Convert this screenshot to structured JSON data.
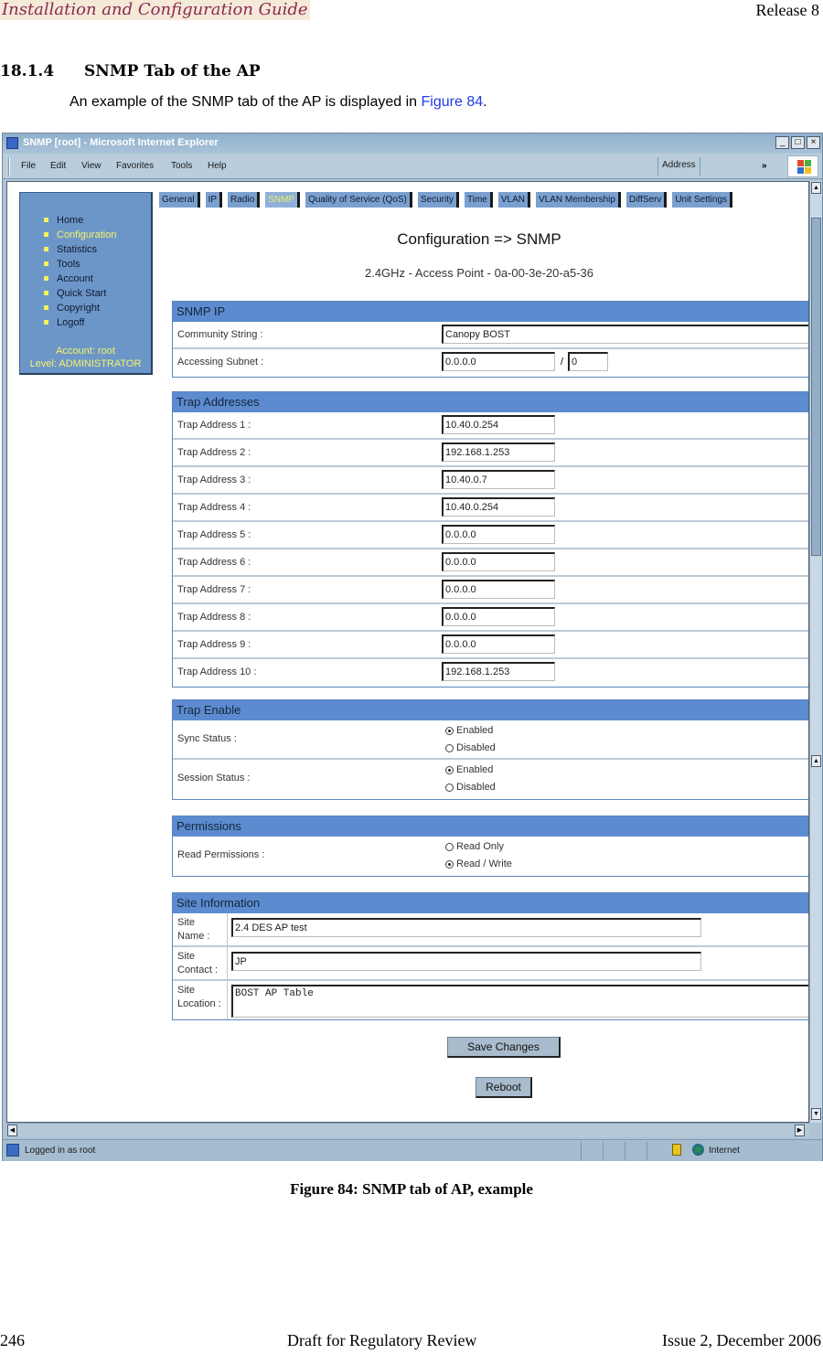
{
  "document": {
    "header_left": "Installation and Configuration Guide",
    "header_right": "Release 8",
    "section_number": "18.1.4",
    "section_title": "SNMP Tab of the AP",
    "intro_text": "An example of the SNMP tab of the AP is displayed in ",
    "intro_link": "Figure 84",
    "intro_end": ".",
    "caption": "Figure 84: SNMP tab of AP, example",
    "footer_page": "246",
    "footer_center": "Draft for Regulatory Review",
    "footer_right": "Issue 2, December 2006"
  },
  "browser": {
    "title": "SNMP [root] - Microsoft Internet Explorer",
    "menu": [
      "File",
      "Edit",
      "View",
      "Favorites",
      "Tools",
      "Help"
    ],
    "address_label": "Address",
    "chevron": "»",
    "status_text": "Logged in as root",
    "zone_text": "Internet",
    "win_buttons": [
      "_",
      "□",
      "×"
    ]
  },
  "nav": {
    "items": [
      {
        "label": "Home",
        "active": false
      },
      {
        "label": "Configuration",
        "active": true
      },
      {
        "label": "Statistics",
        "active": false
      },
      {
        "label": "Tools",
        "active": false
      },
      {
        "label": "Account",
        "active": false
      },
      {
        "label": "Quick Start",
        "active": false
      },
      {
        "label": "Copyright",
        "active": false
      },
      {
        "label": "Logoff",
        "active": false
      }
    ],
    "account_line": "Account: root",
    "level_line": "Level: ADMINISTRATOR"
  },
  "tabs": [
    "General",
    "IP",
    "Radio",
    "SNMP",
    "Quality of Service (QoS)",
    "Security",
    "Time",
    "VLAN",
    "VLAN Membership",
    "DiffServ",
    "Unit Settings"
  ],
  "active_tab": "SNMP",
  "page": {
    "title": "Configuration => SNMP",
    "subtitle": "2.4GHz - Access Point - 0a-00-3e-20-a5-36"
  },
  "snmp_ip": {
    "header": "SNMP IP",
    "community_label": "Community String :",
    "community_value": "Canopy BOST",
    "subnet_label": "Accessing Subnet :",
    "subnet_value": "0.0.0.0",
    "subnet_separator": "/",
    "mask_value": "0"
  },
  "trap_addresses": {
    "header": "Trap Addresses",
    "rows": [
      {
        "label": "Trap Address 1 :",
        "value": "10.40.0.254"
      },
      {
        "label": "Trap Address 2 :",
        "value": "192.168.1.253"
      },
      {
        "label": "Trap Address 3 :",
        "value": "10.40.0.7"
      },
      {
        "label": "Trap Address 4 :",
        "value": "10.40.0.254"
      },
      {
        "label": "Trap Address 5 :",
        "value": "0.0.0.0"
      },
      {
        "label": "Trap Address 6 :",
        "value": "0.0.0.0"
      },
      {
        "label": "Trap Address 7 :",
        "value": "0.0.0.0"
      },
      {
        "label": "Trap Address 8 :",
        "value": "0.0.0.0"
      },
      {
        "label": "Trap Address 9 :",
        "value": "0.0.0.0"
      },
      {
        "label": "Trap Address 10 :",
        "value": "192.168.1.253"
      }
    ]
  },
  "trap_enable": {
    "header": "Trap Enable",
    "sync_label": "Sync Status :",
    "session_label": "Session Status :",
    "enabled": "Enabled",
    "disabled": "Disabled",
    "sync_selected": "Enabled",
    "session_selected": "Enabled"
  },
  "permissions": {
    "header": "Permissions",
    "label": "Read Permissions :",
    "read_only": "Read Only",
    "read_write": "Read / Write",
    "selected": "Read / Write"
  },
  "site_info": {
    "header": "Site Information",
    "name_label_1": "Site",
    "name_label_2": "Name :",
    "name_value": "2.4 DES AP test",
    "contact_label_1": "Site",
    "contact_label_2": "Contact :",
    "contact_value": "JP",
    "location_label_1": "Site",
    "location_label_2": "Location :",
    "location_value": "BOST AP Table"
  },
  "buttons": {
    "save": "Save Changes",
    "reboot": "Reboot"
  }
}
